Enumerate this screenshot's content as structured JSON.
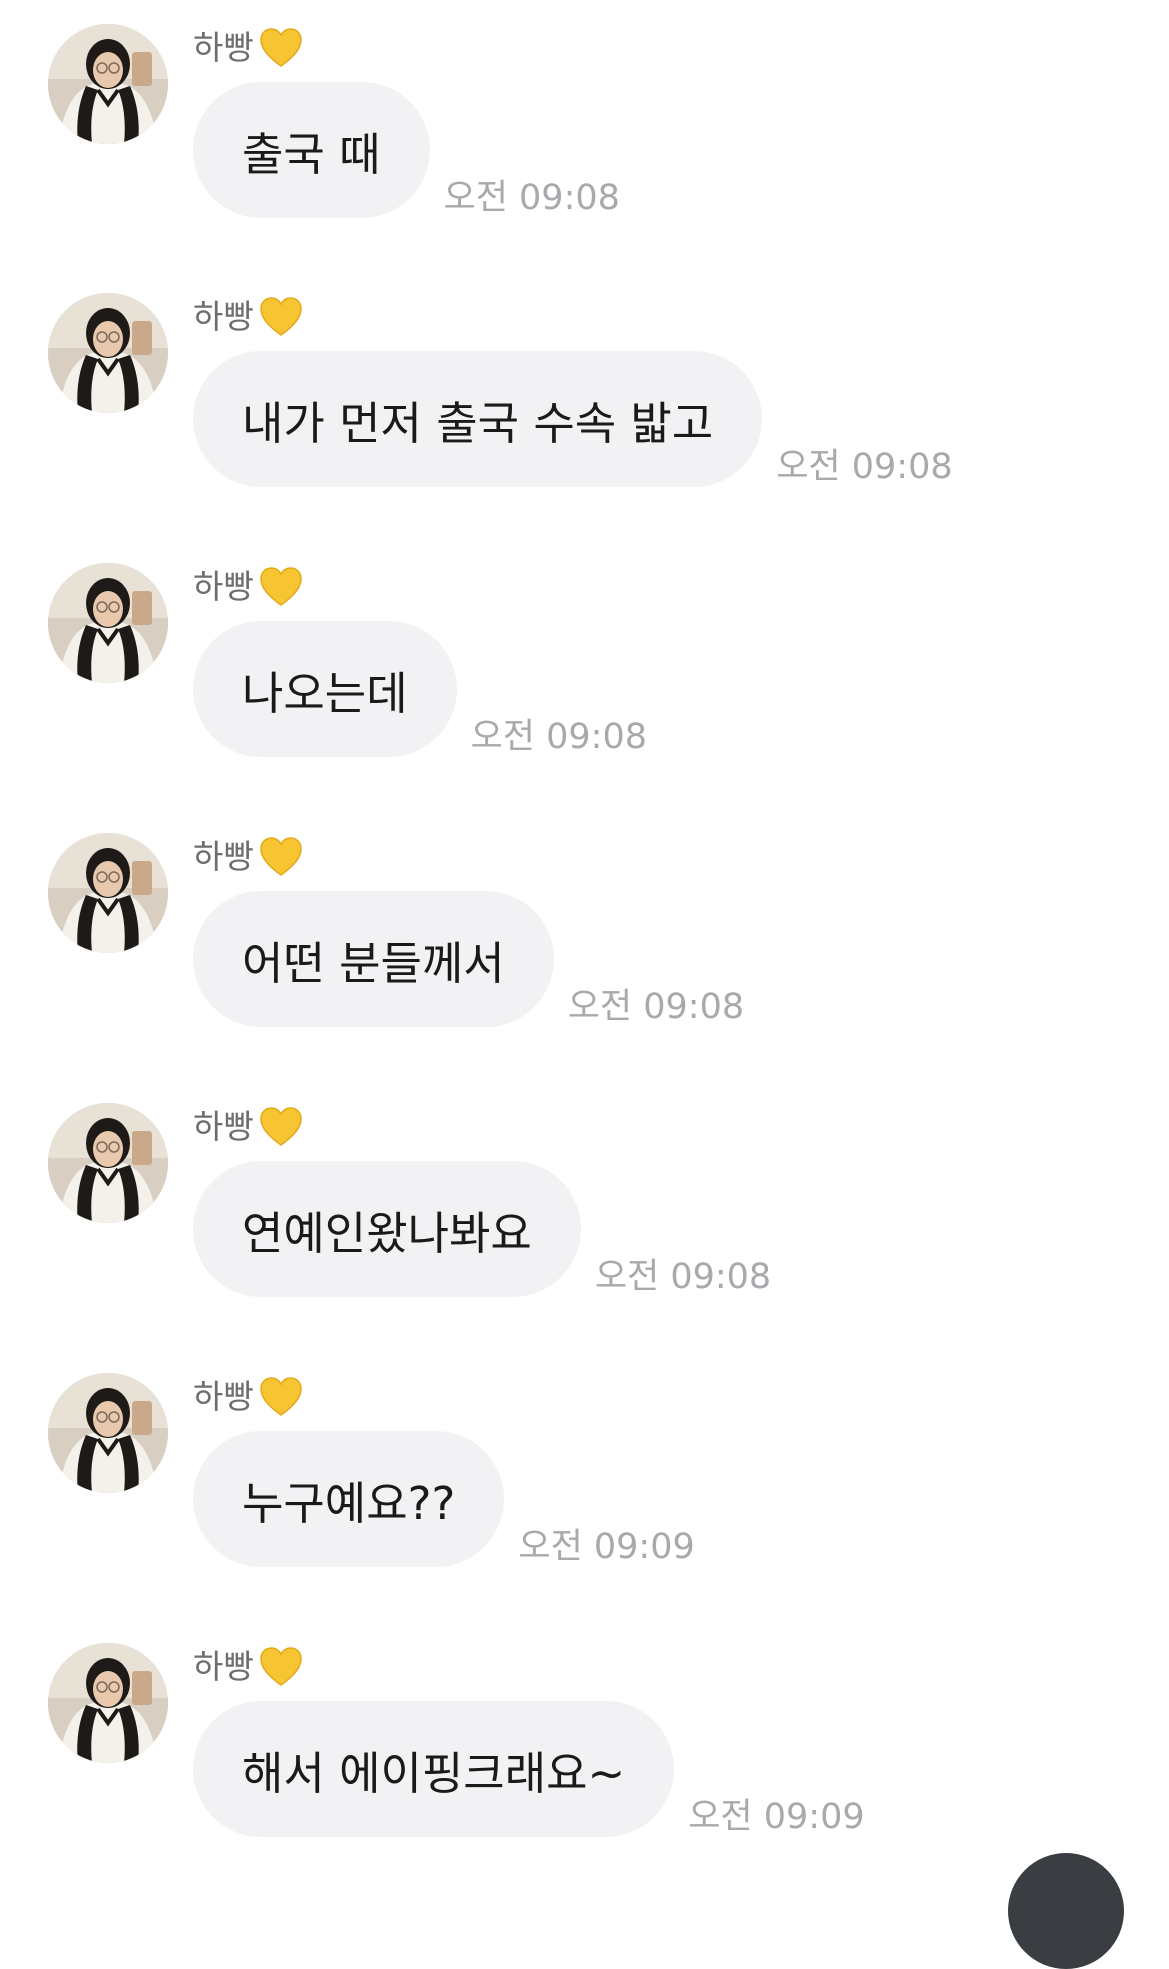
{
  "chat": {
    "messages": [
      {
        "sender": "하빵",
        "text": "출국 때",
        "time": "오전 09:08"
      },
      {
        "sender": "하빵",
        "text": "내가 먼저 출국 수속 밟고",
        "time": "오전 09:08"
      },
      {
        "sender": "하빵",
        "text": "나오는데",
        "time": "오전 09:08"
      },
      {
        "sender": "하빵",
        "text": "어떤 분들께서",
        "time": "오전 09:08"
      },
      {
        "sender": "하빵",
        "text": "연예인왔나봐요",
        "time": "오전 09:08"
      },
      {
        "sender": "하빵",
        "text": "누구예요??",
        "time": "오전 09:09"
      },
      {
        "sender": "하빵",
        "text": "해서 에이핑크래요~",
        "time": "오전 09:09"
      }
    ]
  },
  "icons": {
    "sender_badge": "yellow-heart-icon",
    "avatar": "profile-photo"
  },
  "colors": {
    "bubble": "#f2f2f4",
    "timestamp": "#a9a9ad",
    "heart": "#f7c531",
    "scroll_button": "#3a3d42"
  }
}
